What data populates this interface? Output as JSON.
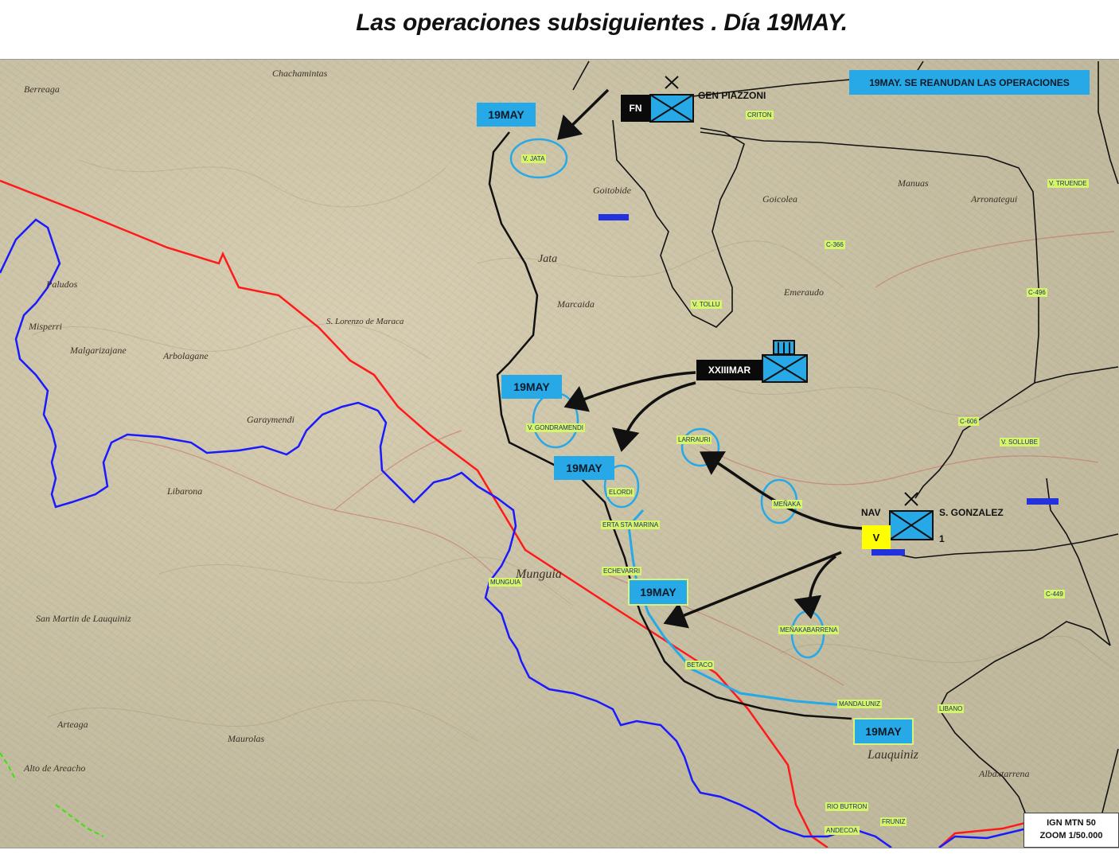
{
  "title": "Las operaciones subsiguientes . Día 19MAY.",
  "notice": "19MAY. SE REANUDAN LAS OPERACIONES",
  "dates": {
    "d1": "19MAY",
    "d2": "19MAY",
    "d3": "19MAY",
    "d4": "19MAY",
    "d5": "19MAY"
  },
  "units": {
    "fn_code": "FN",
    "fn_commander": "GEN PIAZZONI",
    "xxiii_code": "XXIIIMAR",
    "nav_code": "NAV",
    "nav_commander": "S. GONZALEZ",
    "nav_brigade": "V",
    "nav_number": "1"
  },
  "places": {
    "jata": "V. JATA",
    "tollu": "V. TOLLU",
    "gondramendi": "V. GONDRAMENDI",
    "larrauri": "LARRAURI",
    "elordi": "ELORDI",
    "menaka": "MEÑAKA",
    "erta": "ERTA STA MARINA",
    "echevarri": "ECHEVARRI",
    "mungia": "MUNGUIA",
    "menakabarrena": "MEÑAKABARRENA",
    "betaco": "BETACO",
    "mandaluniz": "MANDALUNIZ",
    "libano": "LIBANO",
    "rio_butron": "RIO BUTRON",
    "fruniz": "FRUNIZ",
    "andecoa": "ANDECOA",
    "criton": "CRITON",
    "truende": "V. TRUENDE",
    "sollube": "V. SOLLUBE",
    "c366": "C-366",
    "c496": "C-496",
    "c606": "C-606",
    "c449": "C-449"
  },
  "map_text": {
    "t1": "Chachamintas",
    "t2": "Berreaga",
    "t3": "Goitobide",
    "t4": "Goicolea",
    "t5": "Manuas",
    "t6": "Arronategui",
    "t7": "Jata",
    "t8": "Marcaida",
    "t9": "Emeraudo",
    "t10": "Paludos",
    "t11": "Misperri",
    "t12": "Malgarizajane",
    "t13": "Arbolagane",
    "t14": "S. Lorenzo de Maraca",
    "t15": "Munguia",
    "t16": "San Martin de Lauquiniz",
    "t17": "Maurolas",
    "t18": "Libarona",
    "t19": "Garaymendi",
    "t20": "Arteaga",
    "t21": "Alto de Areacho",
    "t22": "Albaxtarrena",
    "t23": "Lauquiniz"
  },
  "scale": {
    "line1": "IGN MTN 50",
    "line2": "ZOOM 1/50.000"
  },
  "colors": {
    "arrow_blue": "#26a9e6",
    "front_red": "#ff1a1a",
    "river_blue": "#1a1aff",
    "label_yellow": "#d6f56a"
  }
}
